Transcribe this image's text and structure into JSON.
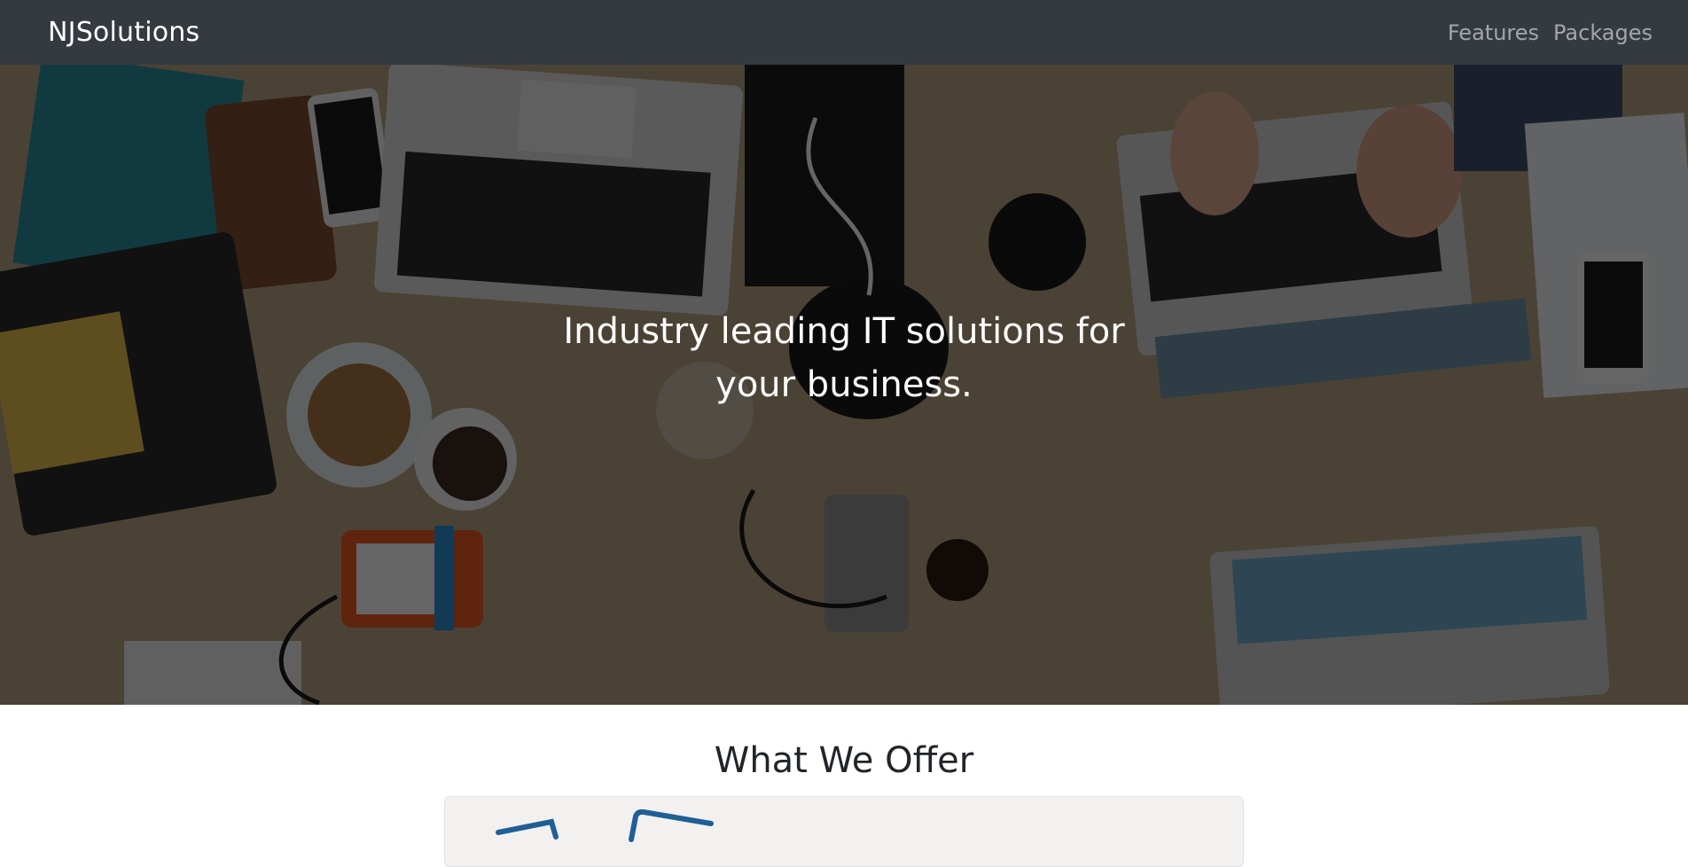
{
  "navbar": {
    "brand": "NJSolutions",
    "links": [
      {
        "label": "Features"
      },
      {
        "label": "Packages"
      }
    ]
  },
  "hero": {
    "heading": "Industry leading IT solutions for your business."
  },
  "offer": {
    "heading": "What We Offer"
  },
  "colors": {
    "navbar_bg": "#343a40",
    "nav_link": "rgba(255,255,255,0.55)",
    "brand_text": "#ffffff",
    "offer_card_bg": "#f2f1ef",
    "illustration_blue": "#1f5f96"
  },
  "icons": {
    "hero_background": "desk-with-laptops-photo",
    "offer_illustration": "devices-illustration"
  }
}
